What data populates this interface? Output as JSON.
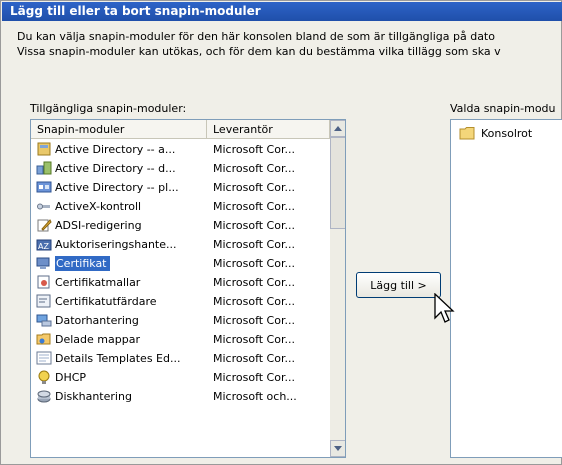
{
  "dialog": {
    "title": "Lägg till eller ta bort snapin-moduler",
    "description_line1": "Du kan välja snapin-moduler för den här konsolen bland de som är tillgängliga på dato",
    "description_line2": "Vissa snapin-moduler kan utökas, och för dem kan du bestämma vilka tillägg som ska v"
  },
  "available": {
    "label": "Tillgängliga snapin-moduler:",
    "columns": [
      "Snapin-moduler",
      "Leverantör"
    ],
    "rows": [
      {
        "name": "Active Directory -- a...",
        "vendor": "Microsoft Cor...",
        "icon": "ad-users-icon"
      },
      {
        "name": "Active Directory -- d...",
        "vendor": "Microsoft Cor...",
        "icon": "ad-domains-icon"
      },
      {
        "name": "Active Directory -- pl...",
        "vendor": "Microsoft Cor...",
        "icon": "ad-sites-icon"
      },
      {
        "name": "ActiveX-kontroll",
        "vendor": "Microsoft Cor...",
        "icon": "activex-icon"
      },
      {
        "name": "ADSI-redigering",
        "vendor": "Microsoft Cor...",
        "icon": "adsi-edit-icon"
      },
      {
        "name": "Auktoriseringshante...",
        "vendor": "Microsoft Cor...",
        "icon": "authorization-icon"
      },
      {
        "name": "Certifikat",
        "vendor": "Microsoft Cor...",
        "icon": "certificates-icon",
        "selected": true
      },
      {
        "name": "Certifikatmallar",
        "vendor": "Microsoft Cor...",
        "icon": "certificate-templates-icon"
      },
      {
        "name": "Certifikatutfärdare",
        "vendor": "Microsoft Cor...",
        "icon": "certificate-authority-icon"
      },
      {
        "name": "Datorhantering",
        "vendor": "Microsoft Cor...",
        "icon": "computer-management-icon"
      },
      {
        "name": "Delade mappar",
        "vendor": "Microsoft Cor...",
        "icon": "shared-folders-icon"
      },
      {
        "name": "Details Templates Ed...",
        "vendor": "Microsoft Cor...",
        "icon": "details-templates-icon"
      },
      {
        "name": "DHCP",
        "vendor": "Microsoft Cor...",
        "icon": "dhcp-icon"
      },
      {
        "name": "Diskhantering",
        "vendor": "Microsoft och...",
        "icon": "disk-management-icon"
      }
    ]
  },
  "add_button_label": "Lägg till >",
  "selected": {
    "label": "Valda snapin-modu",
    "items": [
      {
        "name": "Konsolrot",
        "icon": "folder-icon"
      }
    ]
  },
  "colors": {
    "title_bar": "#2258c0",
    "selection": "#316ac5",
    "list_border": "#7f9db9"
  }
}
